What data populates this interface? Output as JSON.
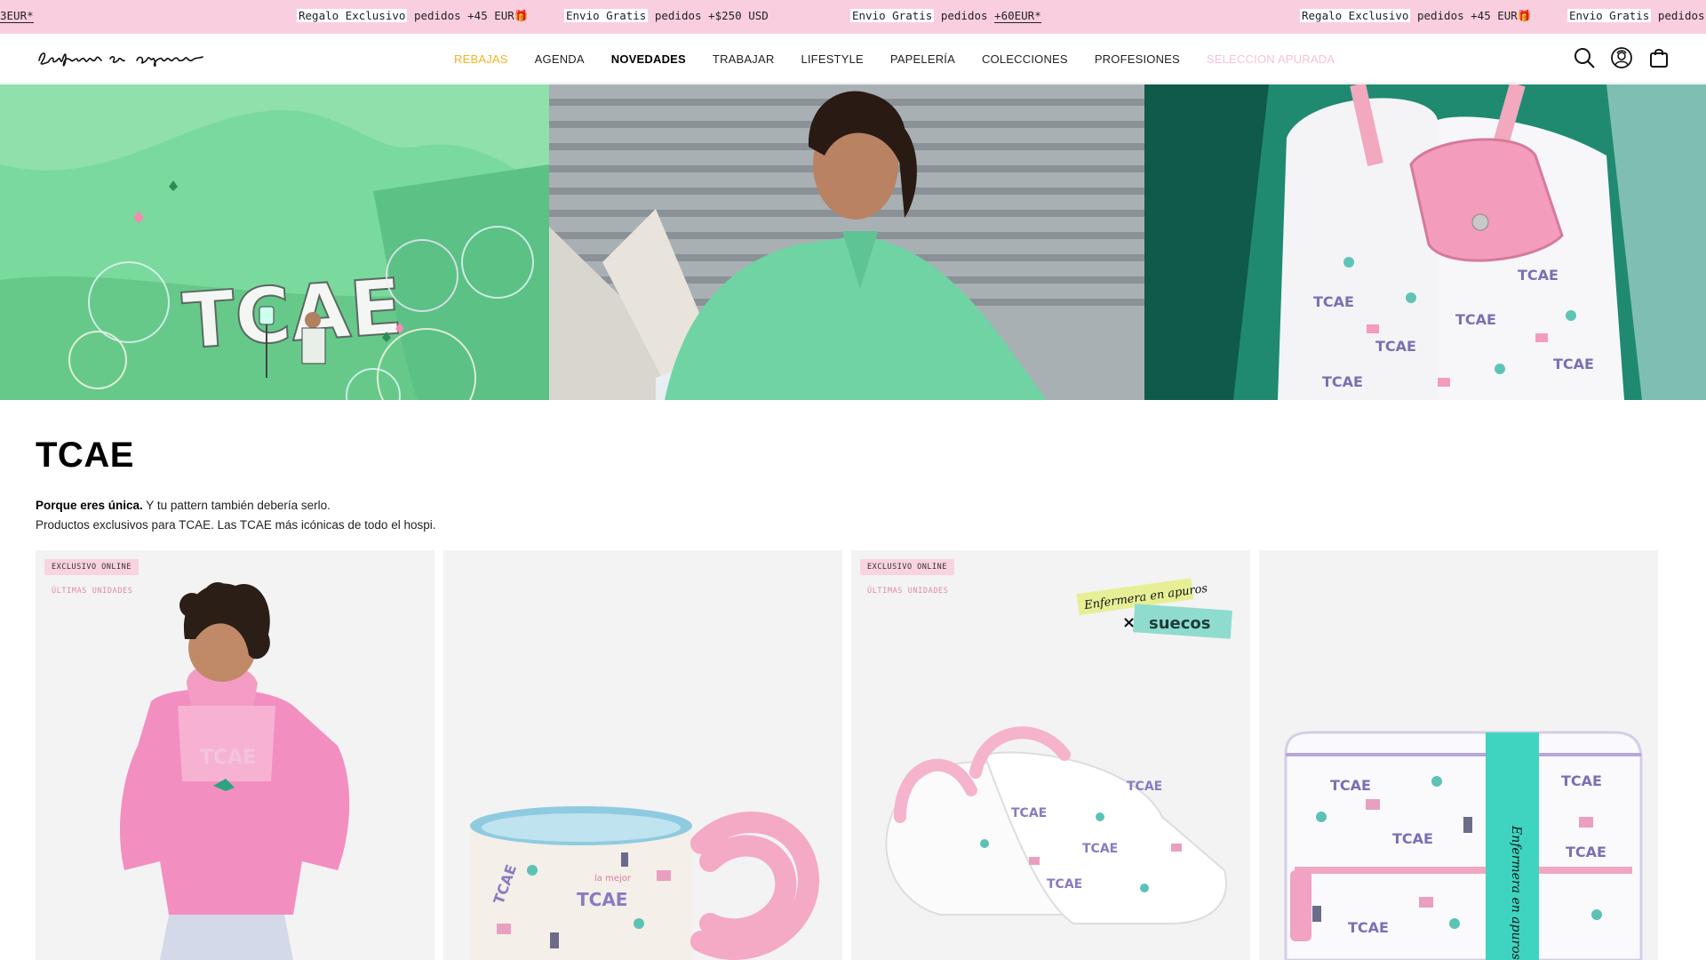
{
  "announcement": {
    "items": [
      {
        "pre": "",
        "hl": "",
        "mid": "",
        "tail": "3EUR*"
      },
      {
        "pre": "",
        "hl": "Regalo Exclusivo",
        "mid": " pedidos +45 EUR",
        "tail": "🎁"
      },
      {
        "pre": "",
        "hl": "Envio Gratis",
        "mid": " pedidos +$250 USD",
        "tail": ""
      },
      {
        "pre": "",
        "hl": "Envio Gratis",
        "mid": " pedidos ",
        "tail": "+60EUR*"
      },
      {
        "pre": "",
        "hl": "Regalo Exclusivo",
        "mid": " pedidos +45 EUR",
        "tail": "🎁"
      },
      {
        "pre": "",
        "hl": "Envio Gratis",
        "mid": " pedidos",
        "tail": ""
      }
    ]
  },
  "header": {
    "logo_text": "Enfermera en apuros",
    "nav": [
      {
        "label": "REBAJAS",
        "style": "sale"
      },
      {
        "label": "AGENDA",
        "style": ""
      },
      {
        "label": "NOVEDADES",
        "style": "bold"
      },
      {
        "label": "TRABAJAR",
        "style": ""
      },
      {
        "label": "LIFESTYLE",
        "style": ""
      },
      {
        "label": "PAPELERÍA",
        "style": ""
      },
      {
        "label": "COLECCIONES",
        "style": ""
      },
      {
        "label": "PROFESIONES",
        "style": ""
      },
      {
        "label": "SELECCION APURADA",
        "style": "faded"
      }
    ],
    "icons": [
      "search-icon",
      "account-icon",
      "cart-icon"
    ]
  },
  "collection": {
    "title": "TCAE",
    "desc_bold": "Porque eres única.",
    "desc_line1": " Y tu pattern también debería serlo.",
    "desc_line2": "Productos exclusivos para TCAE. Las TCAE más icónicas de todo el hospi."
  },
  "products": [
    {
      "badge": "EXCLUSIVO ONLINE",
      "badge2": "ÚLTIMAS UNIDADES",
      "image": "pink-fleece-jacket"
    },
    {
      "badge": "",
      "badge2": "",
      "image": "tcae-mug"
    },
    {
      "badge": "EXCLUSIVO ONLINE",
      "badge2": "ÚLTIMAS UNIDADES",
      "image": "tcae-clogs",
      "collab": "suecos"
    },
    {
      "badge": "",
      "badge2": "",
      "image": "tcae-crossbody-bag"
    }
  ],
  "colors": {
    "announce_bg": "#f9cfe0",
    "sale": "#f1b520",
    "faded_nav": "#f4c3d4",
    "badge_bg": "#f9d3e0"
  }
}
